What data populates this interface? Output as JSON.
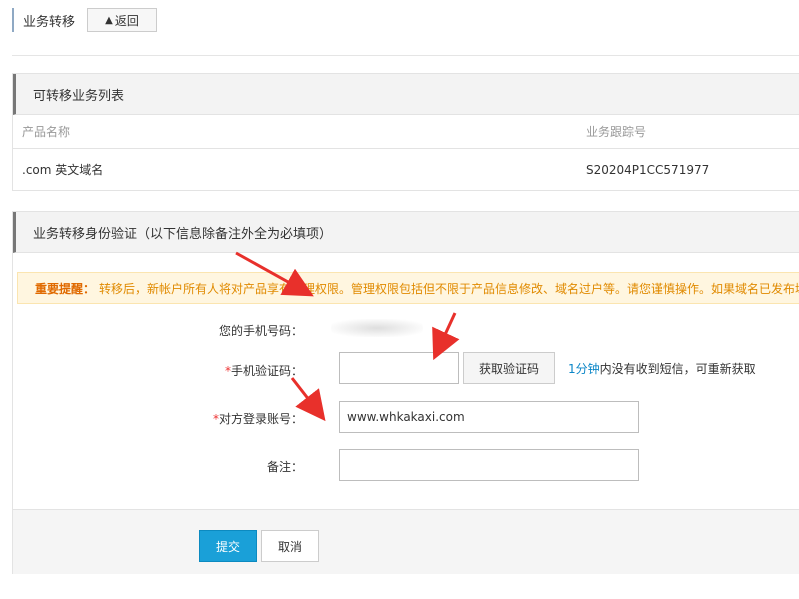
{
  "header": {
    "title": "业务转移",
    "back_label": "返回",
    "back_icon": "arrow-up-icon"
  },
  "list_panel": {
    "title": "可转移业务列表",
    "columns": [
      "产品名称",
      "业务跟踪号"
    ],
    "rows": [
      [
        ".com 英文域名",
        "S20204P1CC571977"
      ]
    ]
  },
  "verify_panel": {
    "title": "业务转移身份验证（以下信息除备注外全为必填项）",
    "notice_label": "重要提醒：",
    "notice_text": "转移后，新帐户所有人将对产品享有管理权限。管理权限包括但不限于产品信息修改、域名过户等。请您谨慎操作。如果域名已发布域名",
    "phone_label": "您的手机号码：",
    "code_label": "手机验证码：",
    "code_value": "",
    "code_button": "获取验证码",
    "code_hint_time": "1分钟",
    "code_hint_text": "内没有收到短信，可重新获取",
    "account_label": "对方登录账号：",
    "account_value": "www.whkakaxi.com",
    "remark_label": "备注：",
    "remark_value": "",
    "required_mark": "*"
  },
  "actions": {
    "submit": "提交",
    "cancel": "取消"
  },
  "colors": {
    "accent": "#1aa0d8",
    "notice_bg": "#fff6e0",
    "arrow": "#e8302b"
  }
}
